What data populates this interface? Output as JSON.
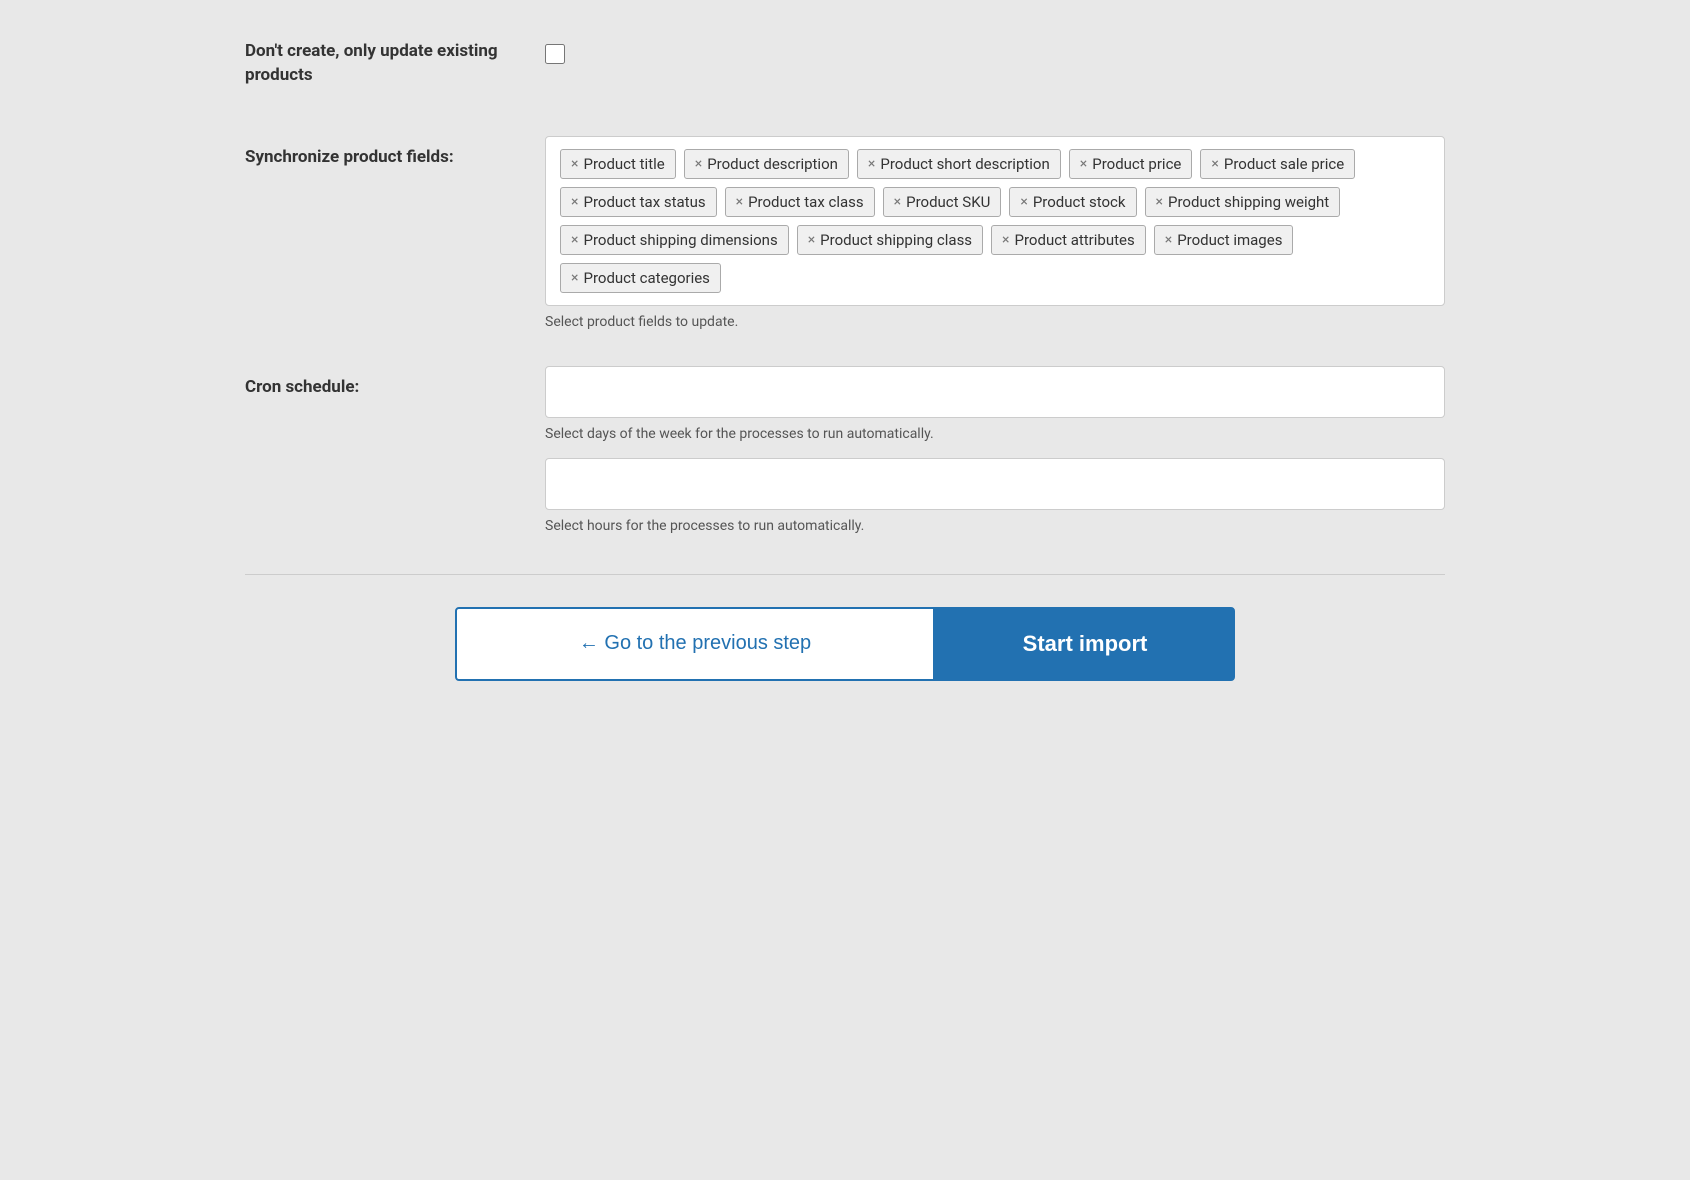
{
  "checkbox": {
    "label": "Don't create, only update existing products"
  },
  "sync_fields": {
    "label": "Synchronize product fields:",
    "help_text": "Select product fields to update.",
    "tags": [
      "Product title",
      "Product description",
      "Product short description",
      "Product price",
      "Product sale price",
      "Product tax status",
      "Product tax class",
      "Product SKU",
      "Product stock",
      "Product shipping weight",
      "Product shipping dimensions",
      "Product shipping class",
      "Product attributes",
      "Product images",
      "Product categories"
    ]
  },
  "cron_schedule": {
    "label": "Cron schedule:",
    "help_text_days": "Select days of the week for the processes to run automatically.",
    "help_text_hours": "Select hours for the processes to run automatically.",
    "days_placeholder": "",
    "hours_placeholder": ""
  },
  "buttons": {
    "prev_label": "← Go to the previous step",
    "start_label": "Start import"
  }
}
